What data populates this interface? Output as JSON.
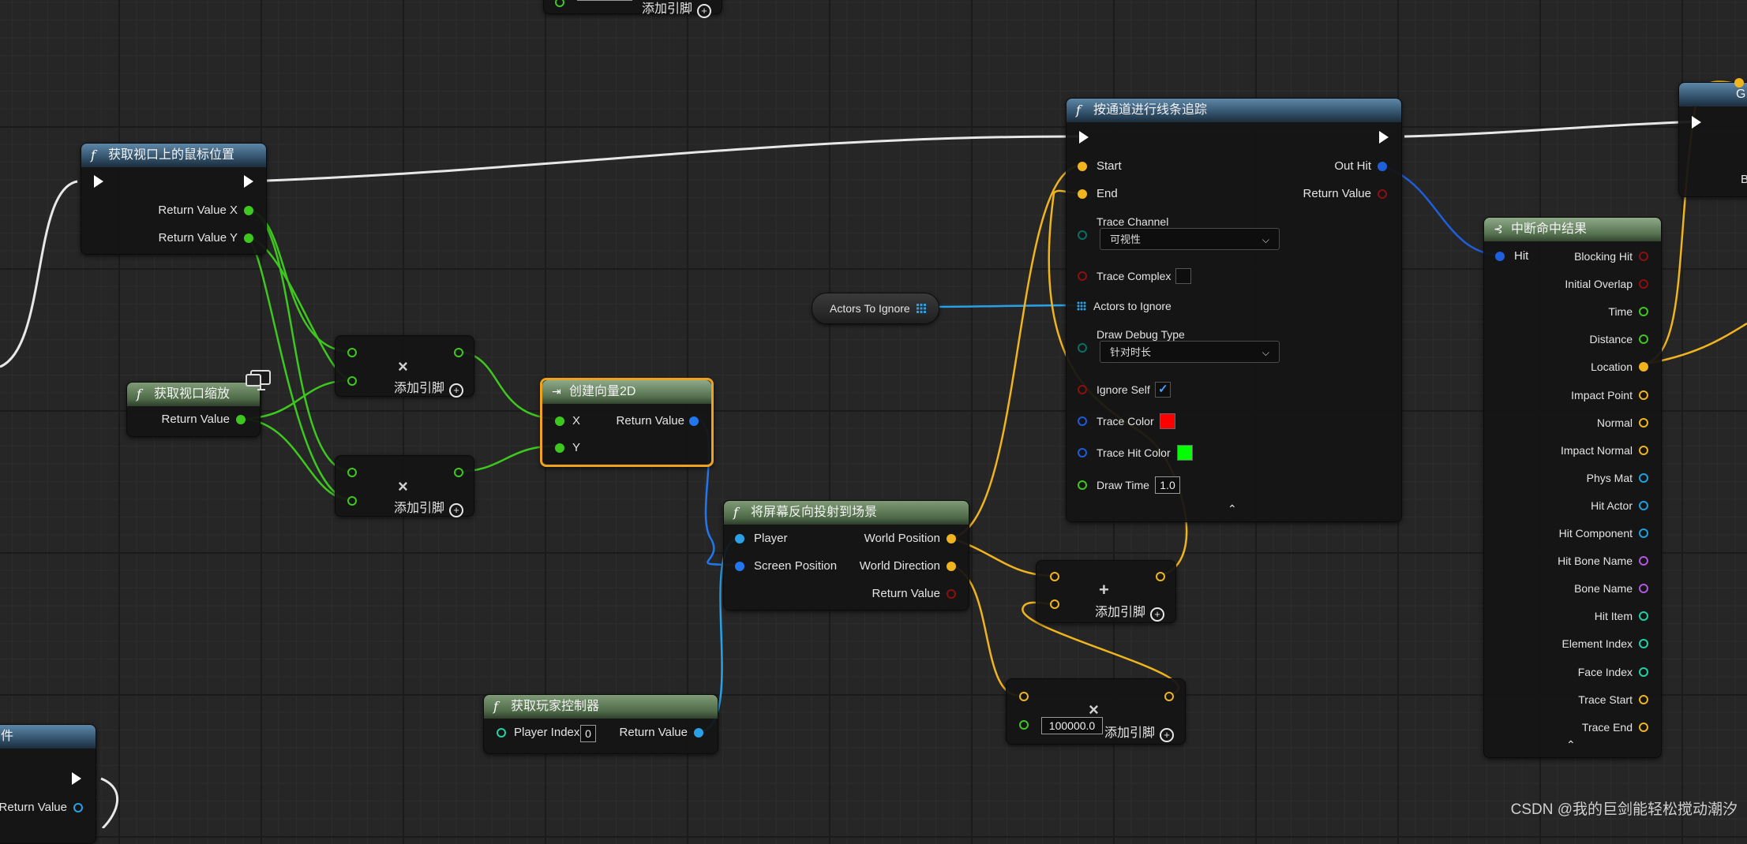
{
  "nodes": {
    "get_mouse": {
      "title": "获取视口上的鼠标位置",
      "out_x": "Return Value X",
      "out_y": "Return Value Y"
    },
    "get_scale": {
      "title": "获取视口缩放",
      "out": "Return Value"
    },
    "mul_1": {
      "add_pin": "添加引脚"
    },
    "mul_2": {
      "add_pin": "添加引脚"
    },
    "make_vec2d": {
      "title": "创建向量2D",
      "in_x": "X",
      "in_y": "Y",
      "out": "Return Value"
    },
    "deproject": {
      "title": "将屏幕反向投射到场景",
      "player": "Player",
      "screen_pos": "Screen Position",
      "world_pos": "World Position",
      "world_dir": "World Direction",
      "ret": "Return Value"
    },
    "get_player_ctrl": {
      "title": "获取玩家控制器",
      "player_index": "Player Index",
      "player_index_value": "0",
      "ret": "Return Value"
    },
    "add_vec": {
      "add_pin": "添加引脚"
    },
    "mul_vec": {
      "value": "100000.0",
      "add_pin": "添加引脚"
    },
    "actors_var": {
      "label": "Actors To Ignore"
    },
    "line_trace": {
      "title": "按通道进行线条追踪",
      "start": "Start",
      "end": "End",
      "out_hit": "Out Hit",
      "ret": "Return Value",
      "trace_channel": "Trace Channel",
      "trace_channel_value": "可视性",
      "trace_complex": "Trace Complex",
      "actors_to_ignore": "Actors to Ignore",
      "draw_debug_type": "Draw Debug Type",
      "draw_debug_value": "针对时长",
      "ignore_self": "Ignore Self",
      "trace_color": "Trace Color",
      "trace_color_hex": "#ff0000",
      "trace_hit_color": "Trace Hit Color",
      "trace_hit_color_hex": "#00ff00",
      "draw_time": "Draw Time",
      "draw_time_value": "1.0"
    },
    "break_hit": {
      "title": "中断命中结果",
      "hit": "Hit",
      "outputs": [
        "Blocking Hit",
        "Initial Overlap",
        "Time",
        "Distance",
        "Location",
        "Impact Point",
        "Normal",
        "Impact Normal",
        "Phys Mat",
        "Hit Actor",
        "Hit Component",
        "Hit Bone Name",
        "Bone Name",
        "Hit Item",
        "Element Index",
        "Face Index",
        "Trace Start",
        "Trace End"
      ]
    },
    "partial_top_right": {
      "label": "G",
      "label2": "B"
    },
    "partial_top": {
      "add_pin": "添加引脚"
    },
    "partial_bottom_left": {
      "title_fragment": "件",
      "ret": "Return Value"
    }
  },
  "watermark": "CSDN @我的巨剑能轻松搅动潮汐",
  "colors": {
    "exec": "#ffffff",
    "float": "#3ec81f",
    "vector": "#f0b41e",
    "struct_hit": "#1f5fdc",
    "vec2d": "#2277ee",
    "object": "#2aa0e6",
    "bool": "#8c1010",
    "int": "#1ed2a8",
    "name": "#b058e0",
    "enum": "#0a6e64",
    "physmat": "#1ea0e0",
    "linear_color": "#1e5adc"
  }
}
